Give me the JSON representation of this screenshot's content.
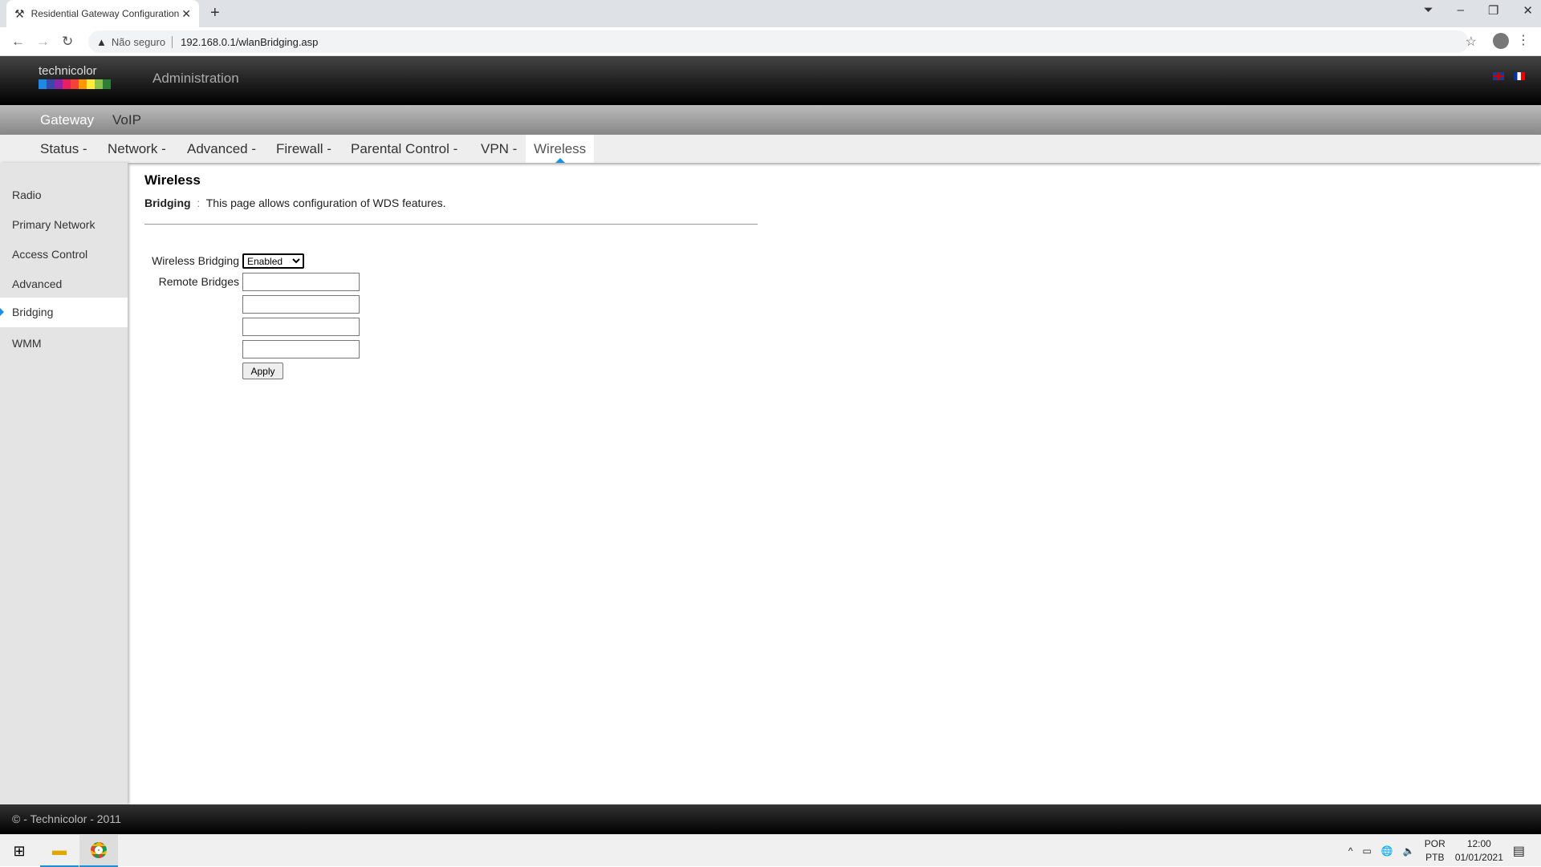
{
  "browser": {
    "tab_title": "Residential Gateway Configuration",
    "tab_icon": "tools-icon",
    "security": "Não seguro",
    "url": "192.168.0.1/wlanBridging.asp"
  },
  "header": {
    "logo_text": "technicolor",
    "title": "Administration"
  },
  "top_nav": [
    "Gateway",
    "VoIP"
  ],
  "menu": [
    "Status -",
    "Network -",
    "Advanced -",
    "Firewall -",
    "Parental Control -",
    "VPN -",
    "Wireless"
  ],
  "sidebar": {
    "items": [
      {
        "label": "Radio"
      },
      {
        "label": "Primary Network"
      },
      {
        "label": "Access Control"
      },
      {
        "label": "Advanced"
      },
      {
        "label": "Bridging",
        "selected": true
      },
      {
        "label": "WMM"
      }
    ]
  },
  "page": {
    "title": "Wireless",
    "subtitle_bold": "Bridging",
    "subtitle_sep": ":",
    "description": "This page allows configuration of WDS features.",
    "wireless_bridging_label": "Wireless Bridging",
    "wireless_bridging_value": "Enabled",
    "remote_bridges_label": "Remote Bridges",
    "remote_bridges": [
      "",
      "",
      "",
      ""
    ],
    "apply_label": "Apply"
  },
  "footer": {
    "text": "© - Technicolor - 2011"
  },
  "taskbar": {
    "lang1": "POR",
    "lang2": "PTB",
    "time": "12:00",
    "date": "01/01/2021"
  },
  "colors": {
    "accent": "#1a8fe0"
  }
}
